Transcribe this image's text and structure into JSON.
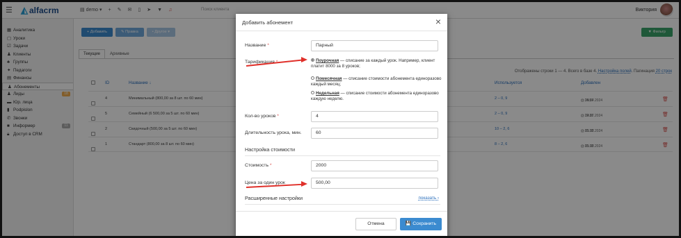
{
  "topbar": {
    "logo_text": "alfacrm",
    "branch": "demo",
    "search_placeholder": "Поиск клиента",
    "user_name": "Виктория",
    "icons": [
      "plus-icon",
      "pencil-icon",
      "mail-icon",
      "phone-icon",
      "send-icon",
      "filter-icon",
      "bell-icon"
    ]
  },
  "sidebar": {
    "items": [
      {
        "icon": "chart-icon",
        "label": "Аналитика"
      },
      {
        "icon": "calendar-icon",
        "label": "Уроки"
      },
      {
        "icon": "tasks-icon",
        "label": "Задачи"
      },
      {
        "icon": "user-icon",
        "label": "Клиенты"
      },
      {
        "icon": "group-icon",
        "label": "Группы"
      },
      {
        "icon": "teacher-icon",
        "label": "Педагоги"
      },
      {
        "icon": "finance-icon",
        "label": "Финансы"
      },
      {
        "icon": "subscription-icon",
        "label": "Абонементы",
        "active": true
      },
      {
        "icon": "leads-icon",
        "label": "Лиды",
        "badge": "18",
        "badge_color": "#f0ad4e"
      },
      {
        "icon": "company-icon",
        "label": "Юр. лица"
      },
      {
        "icon": "podpislon-icon",
        "label": "Podpislon"
      },
      {
        "icon": "phone-icon",
        "label": "Звонки"
      },
      {
        "icon": "informer-icon",
        "label": "Информер",
        "badge": "11",
        "badge_color": "#aaaaaa"
      },
      {
        "icon": "lock-icon",
        "label": "Доступ в CRM"
      }
    ]
  },
  "content": {
    "buttons": {
      "add": "+ Добавить",
      "edit": "✎ Правка",
      "other": "• Другое ▾",
      "filter": "▼ Фильтр"
    },
    "tabs": [
      "Текущие",
      "Архивные"
    ],
    "pagination": {
      "text": "Отображены строки 1 — 4. Всего в базе 4.",
      "settings_link": "Настройка полей",
      "pag_label": "Пагинация",
      "pag_value": "20 строк"
    },
    "columns": {
      "id": "ID",
      "name": "Название ↓",
      "used": "Используется",
      "added": "Добавлен"
    },
    "rows": [
      {
        "id": "4",
        "name": "Минимальный (800,00 за 8 шт. по 60 мин)",
        "used": "2 – 0, 9",
        "time": "⊙ 14:57",
        "date": "▢ 25.04.2024"
      },
      {
        "id": "5",
        "name": "Семейный (6 500,00 за 5 шт. по 60 мин)",
        "used": "2 – 0, 9",
        "time": "⊙ 12:31",
        "date": "▢ 24.07.2024"
      },
      {
        "id": "2",
        "name": "Скидочный (500,00 за 5 шт. по 60 мин)",
        "used": "10 – 2, 6",
        "time": "⊙ 15:18",
        "date": "▢ 01.02.2024"
      },
      {
        "id": "1",
        "name": "Стандарт (800,00 за 8 шт. по 60 мин)",
        "used": "8 – 2, 6",
        "time": "⊙ 15:18",
        "date": "▢ 01.02.2024"
      }
    ]
  },
  "modal": {
    "title": "Добавить абонемент",
    "name_label": "Название",
    "name_value": "Парный",
    "tariff_label": "Тарификация",
    "tariff_options": {
      "per_lesson_name": "Поурочная",
      "per_lesson_desc": " — списание за каждый урок. Например, клиент платит 8000 за 8 уроков;",
      "monthly_name": "Помесячная",
      "monthly_desc": " — списание стоимости абонемента единоразово каждый месяц;",
      "weekly_name": "Недельная",
      "weekly_desc": " — списание стоимости абонемента единоразово каждую неделю."
    },
    "lessons_label": "Кол-во уроков",
    "lessons_value": "4",
    "duration_label": "Длительность урока, мин.",
    "duration_value": "60",
    "cost_section": "Настройка стоимости",
    "cost_label": "Стоимость",
    "cost_value": "2000",
    "per_lesson_label": "Цена за один урок",
    "per_lesson_value": "500,00",
    "advanced_section": "Расширенные настройки",
    "show_link": "показать ›",
    "cancel": "Отмена",
    "save": "💾 Сохранить"
  },
  "colors": {
    "accent": "#2a6ebb",
    "primary_button": "#3b8bd0",
    "filter_button": "#3aa36a",
    "arrow": "#e0302a",
    "danger": "#d9534f"
  }
}
